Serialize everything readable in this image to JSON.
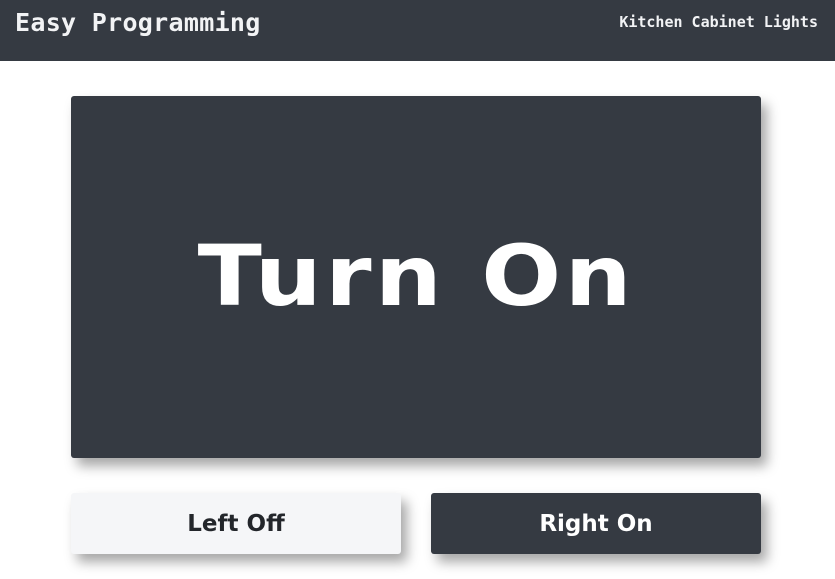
{
  "header": {
    "brand": "Easy Programming",
    "page_title": "Kitchen Cabinet Lights"
  },
  "controls": {
    "main_label": "Turn On",
    "left_label": "Left Off",
    "right_label": "Right On"
  },
  "colors": {
    "header_bg": "#353a42",
    "dark_button": "#353a42",
    "light_button": "#f5f6f8",
    "text_light": "#ffffff",
    "text_dark": "#23262b"
  }
}
